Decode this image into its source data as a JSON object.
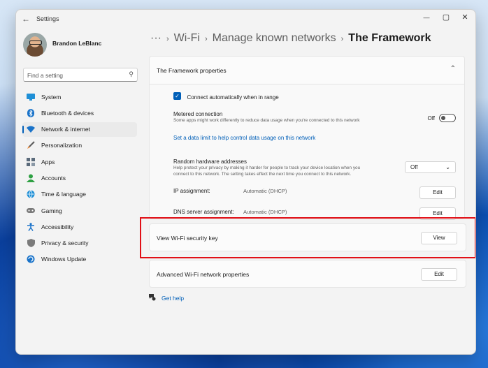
{
  "app": {
    "title": "Settings",
    "back_glyph": "←",
    "minimize_glyph": "—",
    "maximize_glyph": "▢",
    "close_glyph": "✕"
  },
  "user": {
    "name": "Brandon LeBlanc"
  },
  "search": {
    "placeholder": "Find a setting",
    "icon_glyph": "⚲"
  },
  "sidebar": {
    "items": [
      {
        "label": "System",
        "icon": "system-icon",
        "color": "#1f8fd6",
        "active": false
      },
      {
        "label": "Bluetooth & devices",
        "icon": "bluetooth-icon",
        "color": "#1a73c9",
        "active": false
      },
      {
        "label": "Network & internet",
        "icon": "wifi-icon",
        "color": "#1a73c9",
        "active": true
      },
      {
        "label": "Personalization",
        "icon": "brush-icon",
        "color": "#e8893b",
        "active": false
      },
      {
        "label": "Apps",
        "icon": "apps-icon",
        "color": "#5b6b7b",
        "active": false
      },
      {
        "label": "Accounts",
        "icon": "accounts-icon",
        "color": "#2ea043",
        "active": false
      },
      {
        "label": "Time & language",
        "icon": "globe-icon",
        "color": "#1f8fd6",
        "active": false
      },
      {
        "label": "Gaming",
        "icon": "gamepad-icon",
        "color": "#6b6b6b",
        "active": false
      },
      {
        "label": "Accessibility",
        "icon": "accessibility-icon",
        "color": "#1a73c9",
        "active": false
      },
      {
        "label": "Privacy & security",
        "icon": "shield-icon",
        "color": "#7a7a7a",
        "active": false
      },
      {
        "label": "Windows Update",
        "icon": "update-icon",
        "color": "#1a73c9",
        "active": false
      }
    ]
  },
  "breadcrumb": {
    "ellipsis": "···",
    "item1": "Wi-Fi",
    "item2": "Manage known networks",
    "current": "The Framework",
    "sep": "›"
  },
  "properties": {
    "title": "The Framework properties",
    "chevron_glyph": "⌃",
    "connect_auto": {
      "label": "Connect automatically when in range",
      "checked": true
    },
    "metered": {
      "label": "Metered connection",
      "description": "Some apps might work differently to reduce data usage when you're connected to this network",
      "toggle_label": "Off"
    },
    "data_limit_link": "Set a data limit to help control data usage on this network",
    "random_hw": {
      "label": "Random hardware addresses",
      "description_line1": "Help protect your privacy by making it harder for people to track your device location when you",
      "description_line2": "connect to this network. The setting takes effect the next time you connect to this network.",
      "value": "Off"
    },
    "ip": {
      "label": "IP assignment:",
      "value": "Automatic (DHCP)",
      "button": "Edit"
    },
    "dns": {
      "label": "DNS server assignment:",
      "value": "Automatic (DHCP)",
      "button": "Edit"
    }
  },
  "security_key": {
    "label": "View Wi-Fi security key",
    "button": "View"
  },
  "advanced": {
    "label": "Advanced Wi-Fi network properties",
    "button": "Edit"
  },
  "help": {
    "label": "Get help"
  },
  "colors": {
    "accent": "#005fb8",
    "highlight": "#e10f16"
  }
}
